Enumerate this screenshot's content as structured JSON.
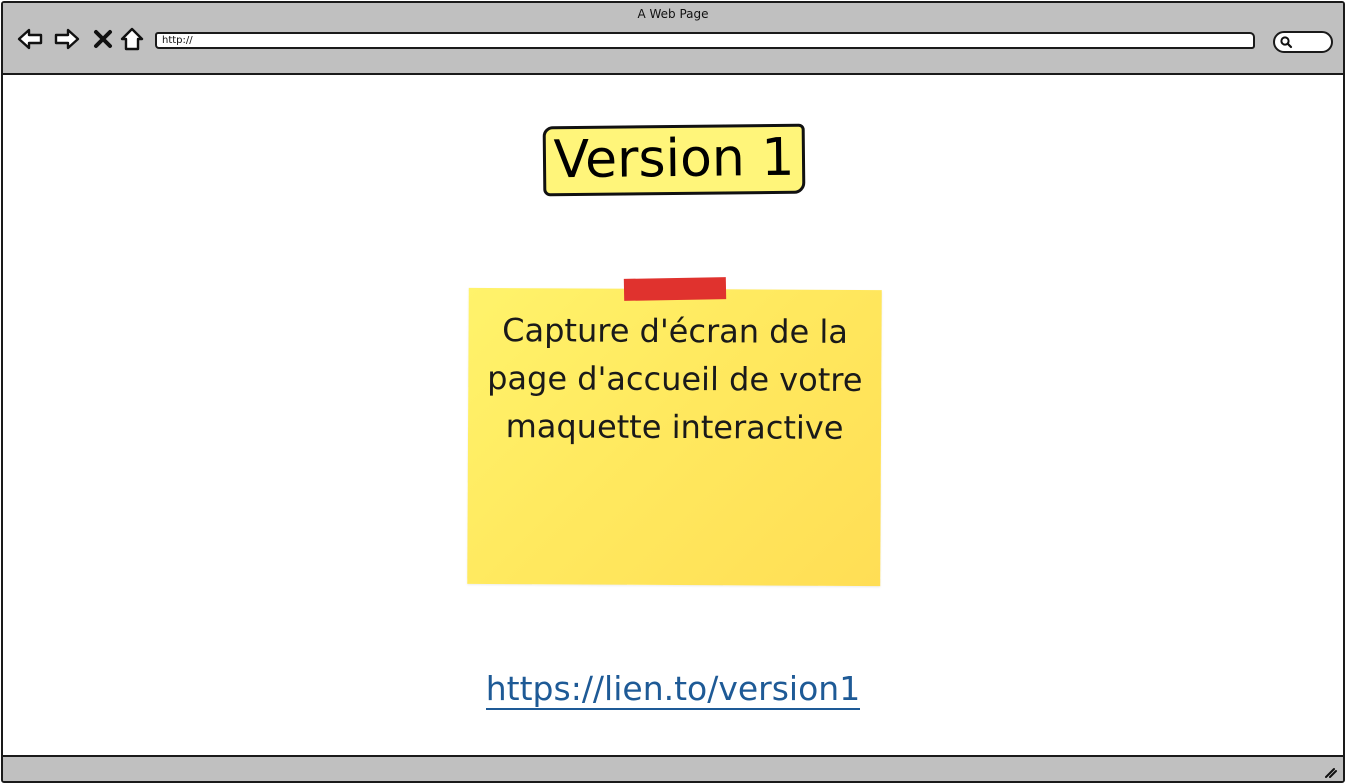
{
  "window": {
    "title": "A Web Page"
  },
  "toolbar": {
    "back_icon": "arrow-left-icon",
    "forward_icon": "arrow-right-icon",
    "stop_icon": "close-icon",
    "home_icon": "home-icon",
    "url_value": "http://",
    "search_icon": "search-icon"
  },
  "main": {
    "version_label": "Version 1",
    "sticky_note_text": "Capture d'écran de la page d'accueil de votre maquette interactive",
    "link_text": "https://lien.to/version1"
  },
  "colors": {
    "chrome_gray": "#c0c0c0",
    "badge_yellow": "#fff57a",
    "sticky_yellow": "#ffe95f",
    "tape_red": "#e0322e",
    "link_blue": "#1e5a96"
  },
  "statusbar": {
    "resize_icon": "resize-grip-icon"
  }
}
